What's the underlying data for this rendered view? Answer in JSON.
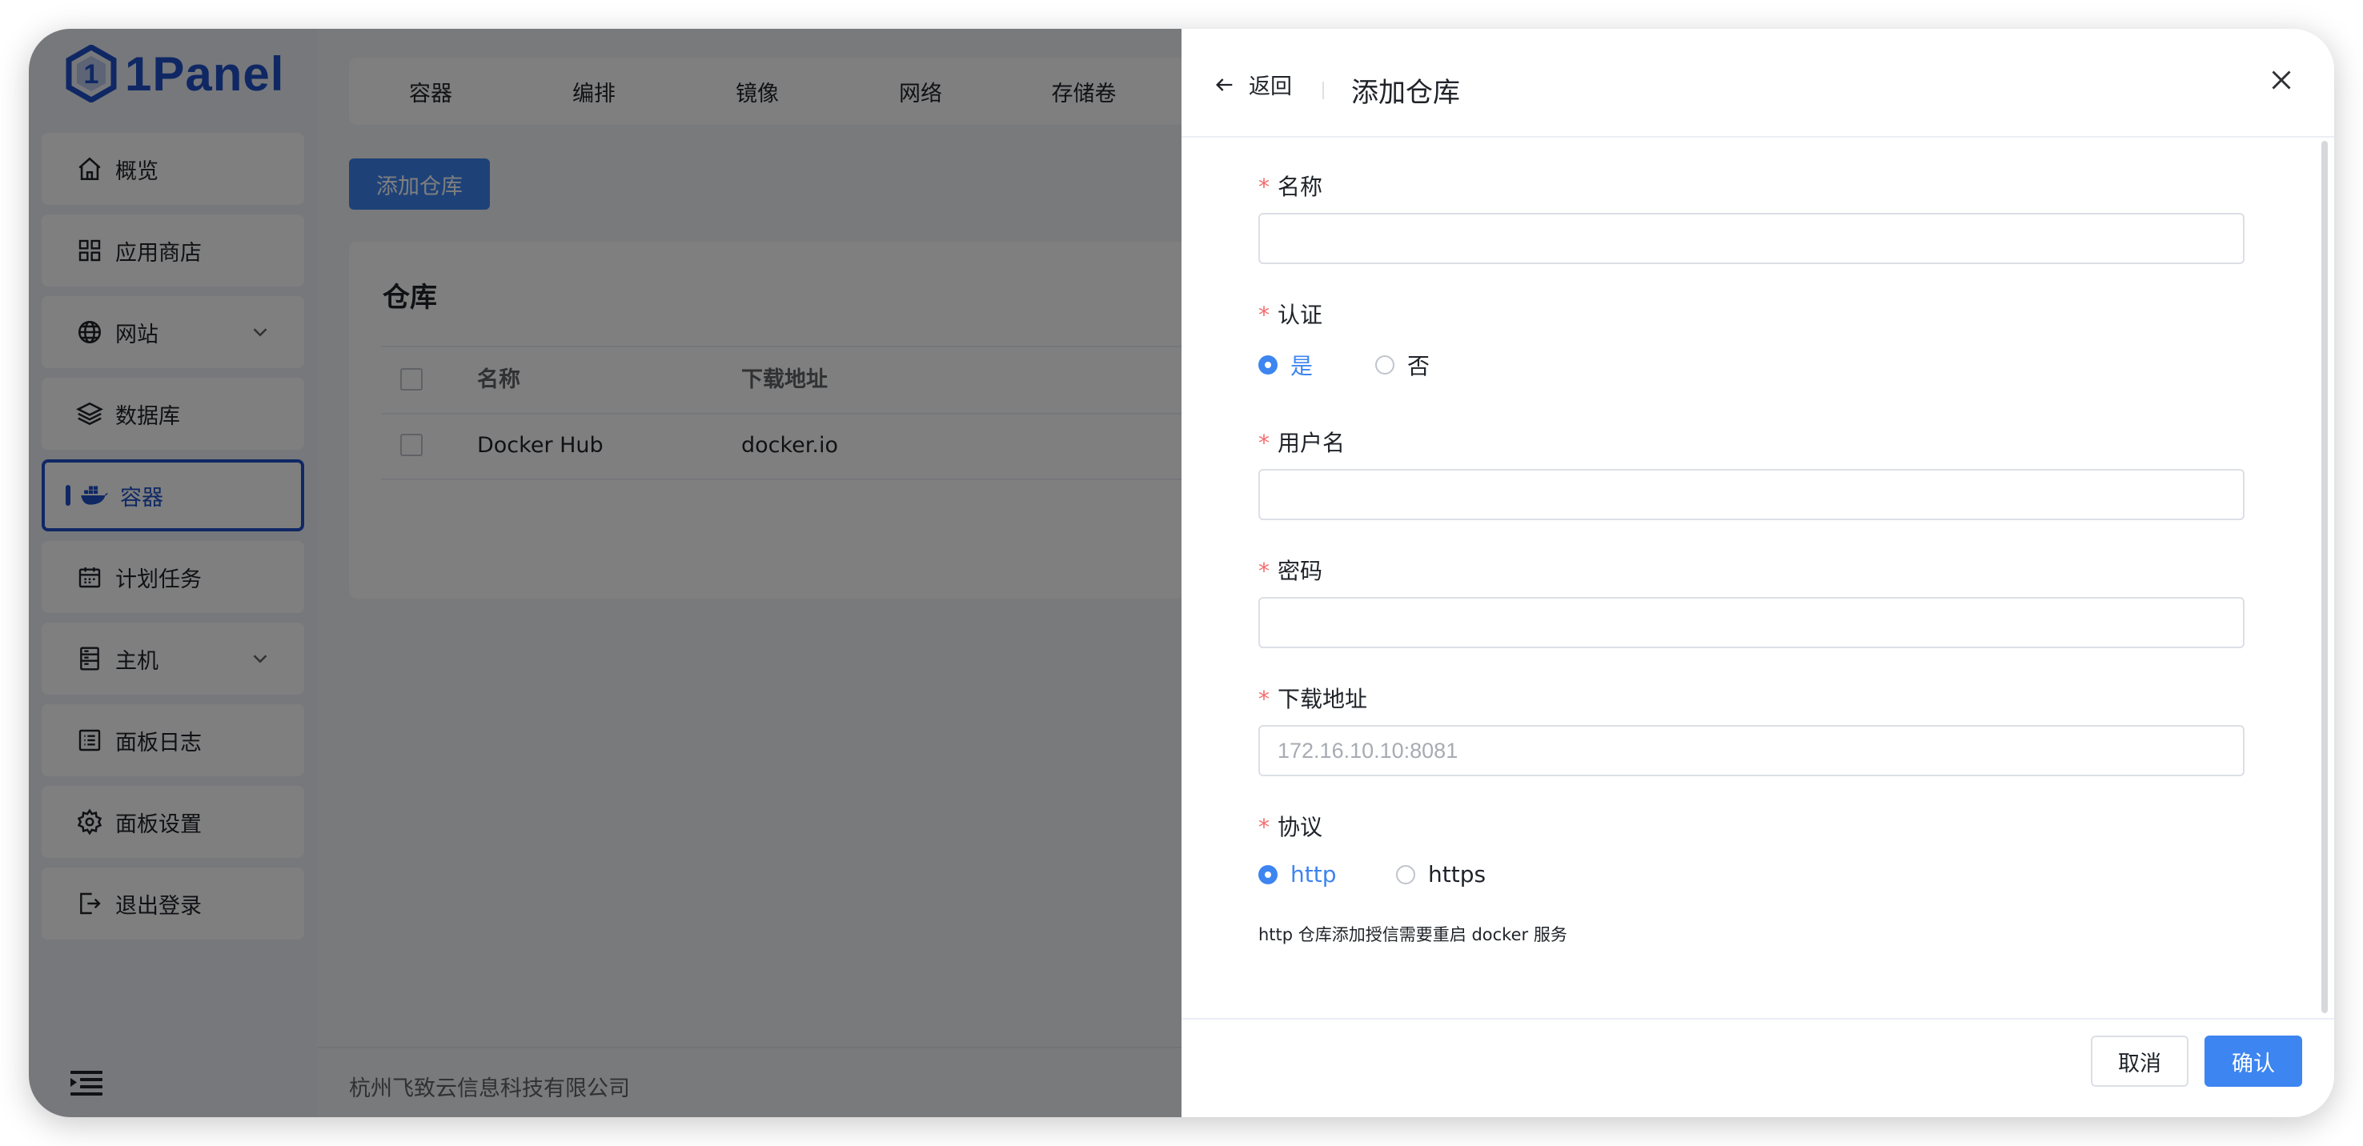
{
  "brand": {
    "name": "1Panel"
  },
  "sidebar": {
    "items": [
      {
        "label": "概览",
        "icon": "home-icon"
      },
      {
        "label": "应用商店",
        "icon": "apps-grid-icon"
      },
      {
        "label": "网站",
        "icon": "globe-icon",
        "expandable": true
      },
      {
        "label": "数据库",
        "icon": "layers-icon"
      },
      {
        "label": "容器",
        "icon": "docker-whale-icon",
        "active": true
      },
      {
        "label": "计划任务",
        "icon": "calendar-icon"
      },
      {
        "label": "主机",
        "icon": "server-icon",
        "expandable": true
      },
      {
        "label": "面板日志",
        "icon": "log-list-icon"
      },
      {
        "label": "面板设置",
        "icon": "gear-icon"
      },
      {
        "label": "退出登录",
        "icon": "logout-icon"
      }
    ]
  },
  "tabs": [
    "容器",
    "编排",
    "镜像",
    "网络",
    "存储卷"
  ],
  "toolbar": {
    "add_label": "添加仓库"
  },
  "repo_card": {
    "title": "仓库",
    "columns": [
      "名称",
      "下载地址"
    ],
    "rows": [
      {
        "name": "Docker Hub",
        "url": "docker.io"
      }
    ]
  },
  "footer": {
    "company": "杭州飞致云信息科技有限公司"
  },
  "drawer": {
    "back_label": "返回",
    "title": "添加仓库",
    "fields": {
      "name": {
        "label": "名称",
        "value": ""
      },
      "auth": {
        "label": "认证",
        "options": [
          "是",
          "否"
        ],
        "selected": "是"
      },
      "username": {
        "label": "用户名",
        "value": ""
      },
      "password": {
        "label": "密码",
        "value": ""
      },
      "download_url": {
        "label": "下载地址",
        "placeholder": "172.16.10.10:8081"
      },
      "protocol": {
        "label": "协议",
        "options": [
          "http",
          "https"
        ],
        "selected": "http"
      }
    },
    "hint": "http 仓库添加授信需要重启 docker 服务",
    "cancel_label": "取消",
    "confirm_label": "确认"
  },
  "colors": {
    "accent": "#3d85f0",
    "brand": "#1e50c8",
    "required": "#f56c6c"
  }
}
